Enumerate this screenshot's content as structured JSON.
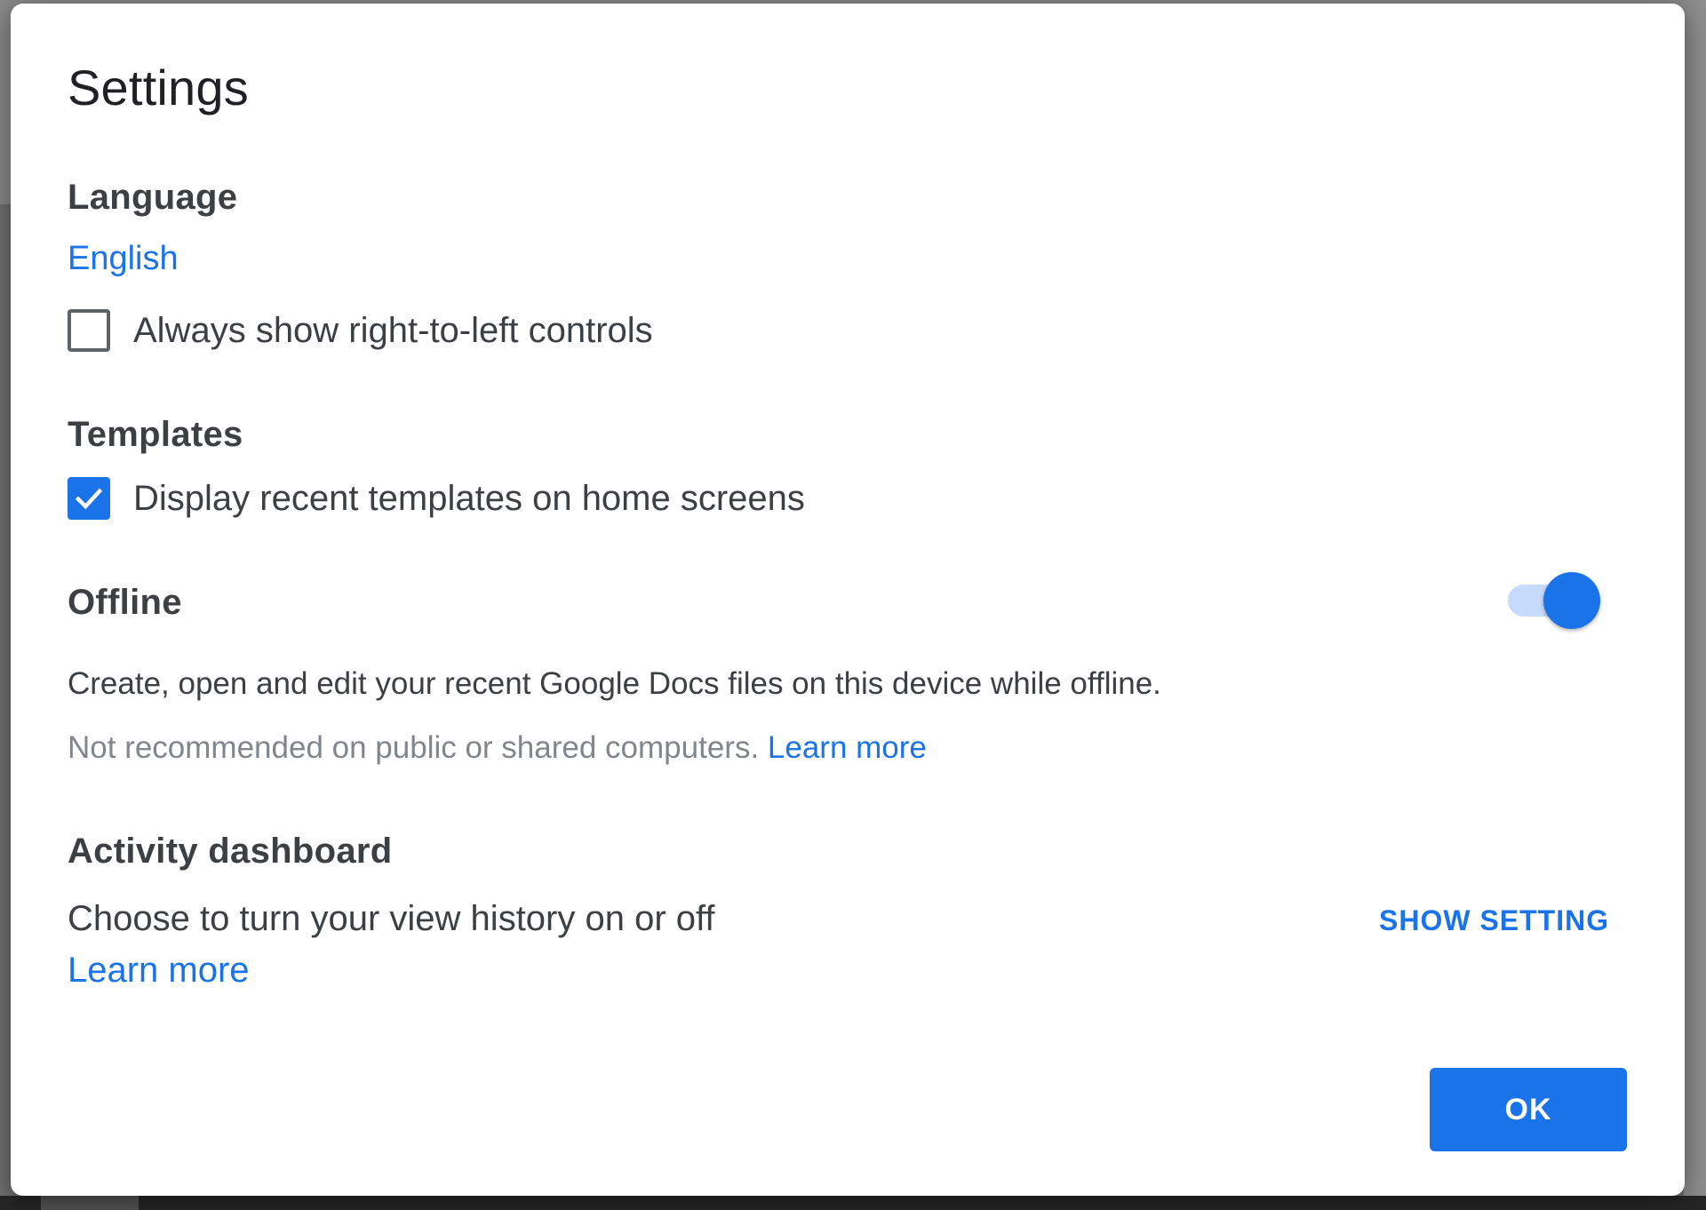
{
  "dialog": {
    "title": "Settings",
    "ok_label": "OK"
  },
  "language": {
    "heading": "Language",
    "current": "English",
    "rtl_label": "Always show right-to-left controls",
    "rtl_checked": false
  },
  "templates": {
    "heading": "Templates",
    "recent_label": "Display recent templates on home screens",
    "recent_checked": true
  },
  "offline": {
    "heading": "Offline",
    "enabled": true,
    "description": "Create, open and edit your recent Google Docs files on this device while offline.",
    "warning": "Not recommended on public or shared computers.",
    "learn_more": "Learn more"
  },
  "activity": {
    "heading": "Activity dashboard",
    "description": "Choose to turn your view history on or off",
    "learn_more": "Learn more",
    "show_setting": "SHOW SETTING"
  },
  "colors": {
    "accent": "#1a73e8",
    "toggle_track": "#c6dafc",
    "text": "#3c4043",
    "muted": "#80868b"
  },
  "icons": {
    "checkmark": "check-icon"
  }
}
